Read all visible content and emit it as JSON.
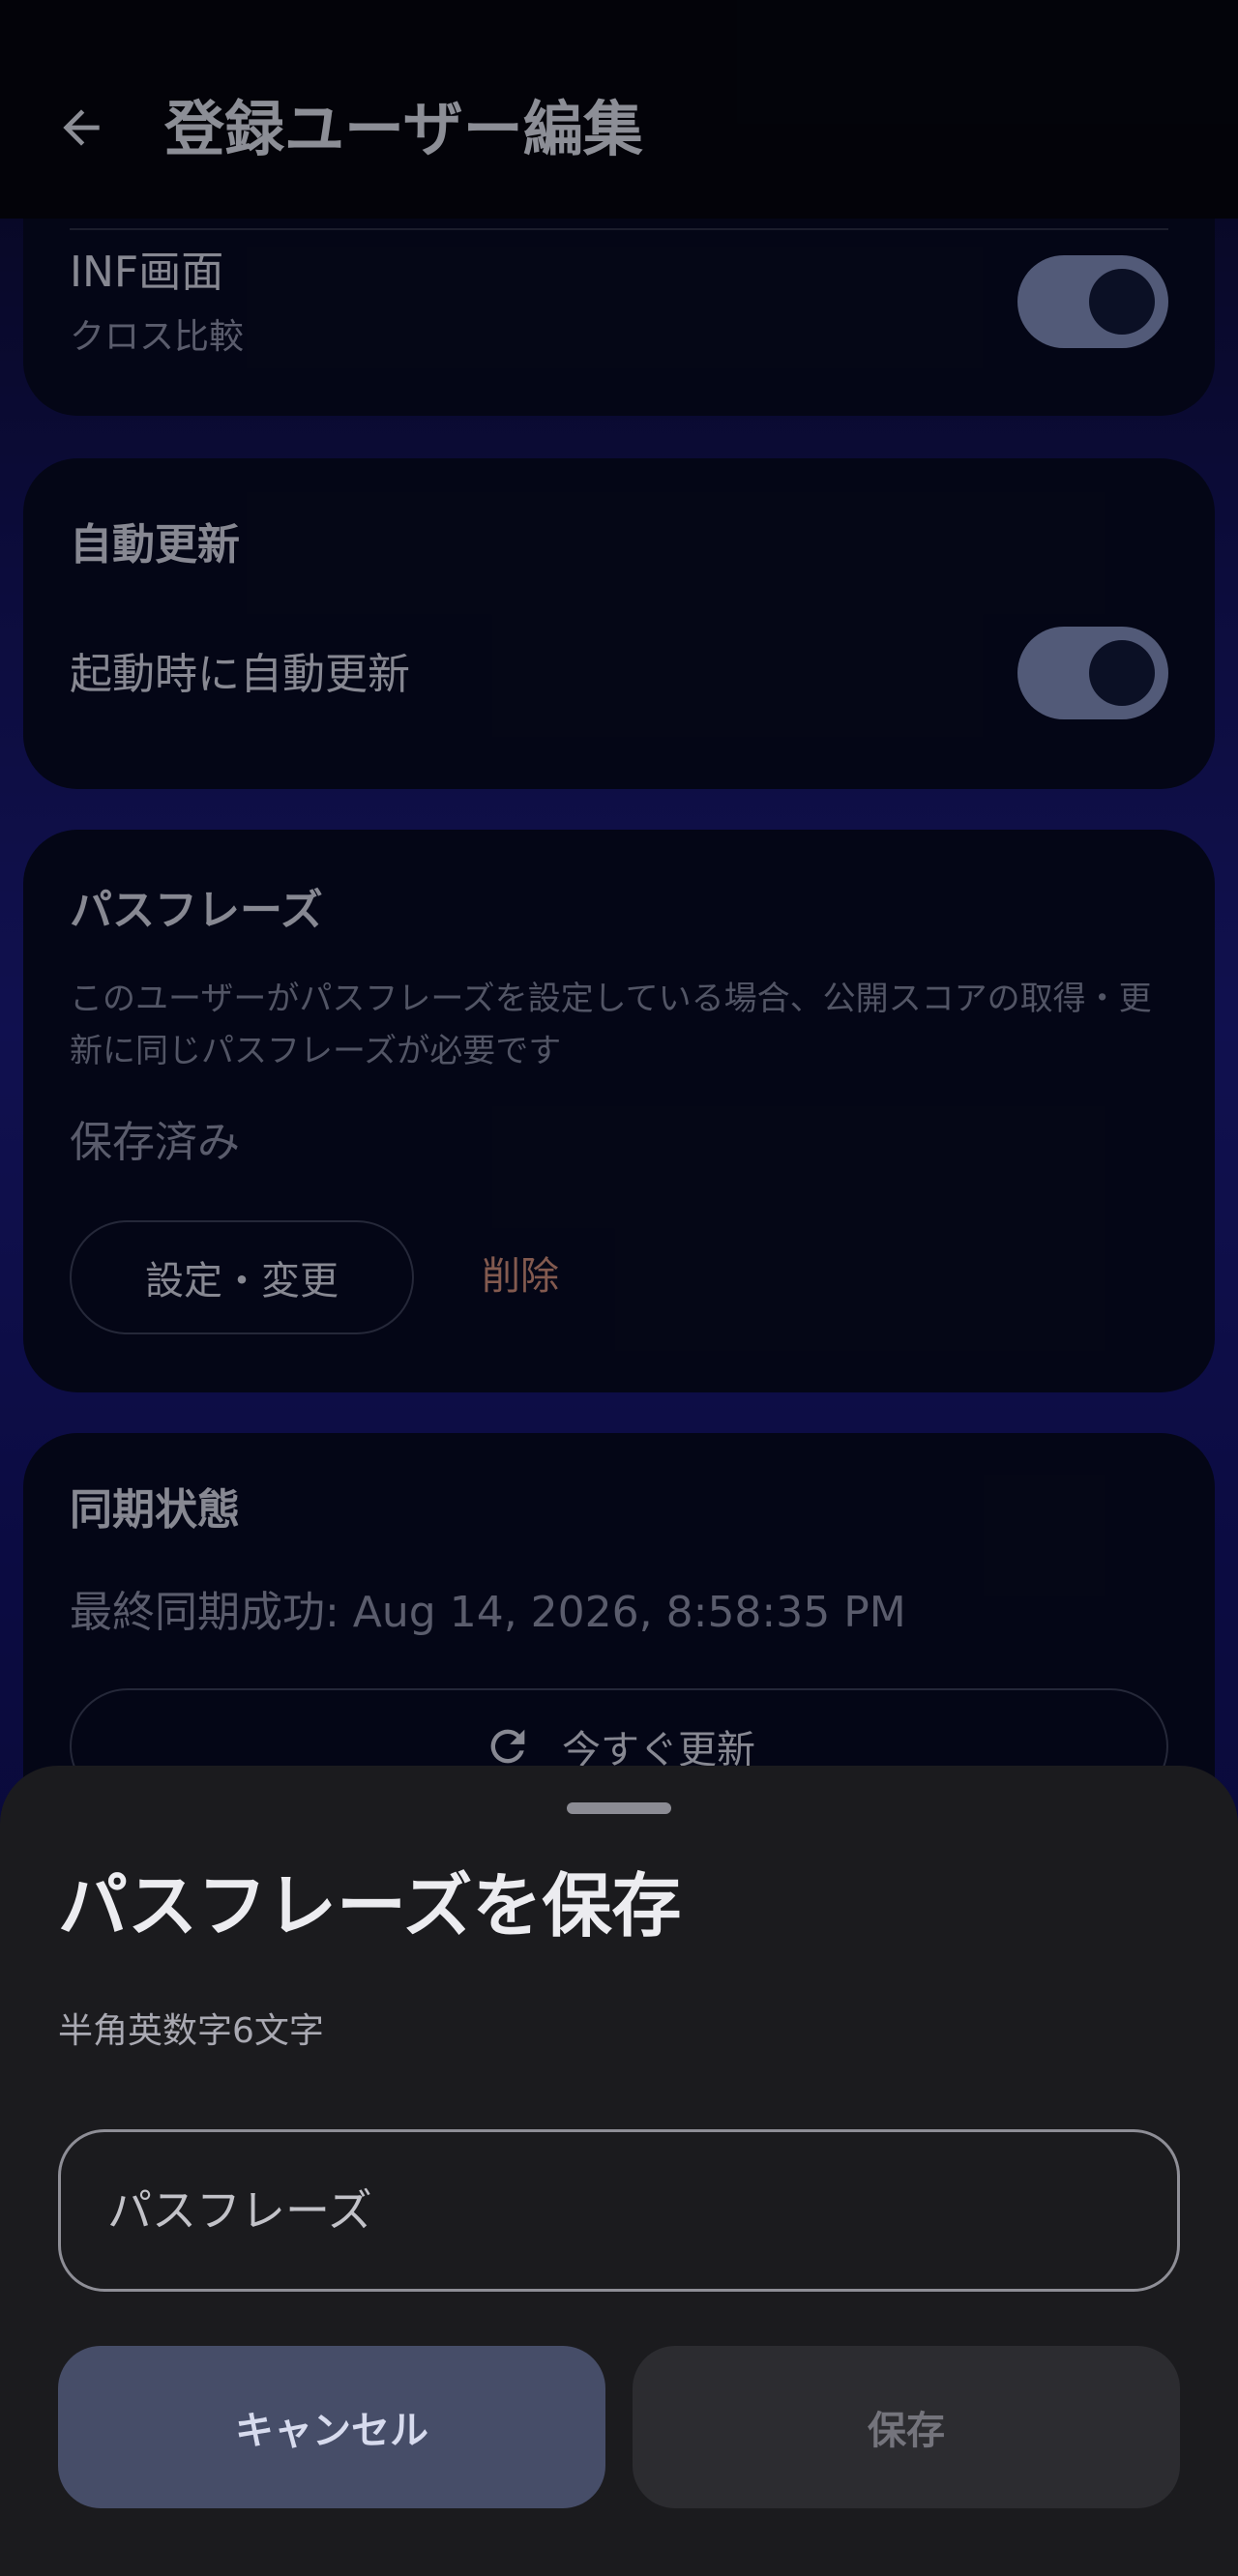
{
  "app_bar": {
    "title": "登録ユーザー編集"
  },
  "inf_row": {
    "title": "INF画面",
    "subtitle": "クロス比較",
    "toggle_on": true
  },
  "auto_update": {
    "section_title": "自動更新",
    "row_label": "起動時に自動更新",
    "toggle_on": true
  },
  "passphrase": {
    "section_title": "パスフレーズ",
    "description": "このユーザーがパスフレーズを設定している場合、公開スコアの取得・更新に同じパスフレーズが必要です",
    "status": "保存済み",
    "set_change_label": "設定・変更",
    "delete_label": "削除"
  },
  "sync": {
    "section_title": "同期状態",
    "last_sync": "最終同期成功: Aug 14, 2026, 8:58:35 PM",
    "refresh_label": "今すぐ更新"
  },
  "sheet": {
    "title": "パスフレーズを保存",
    "hint": "半角英数字6文字",
    "input_placeholder": "パスフレーズ",
    "input_value": "",
    "cancel_label": "キャンセル",
    "save_label": "保存"
  },
  "colors": {
    "accent_toggle": "#7f8ab8",
    "delete_text": "#c98a7a",
    "sheet_bg": "#1b1b1e"
  }
}
